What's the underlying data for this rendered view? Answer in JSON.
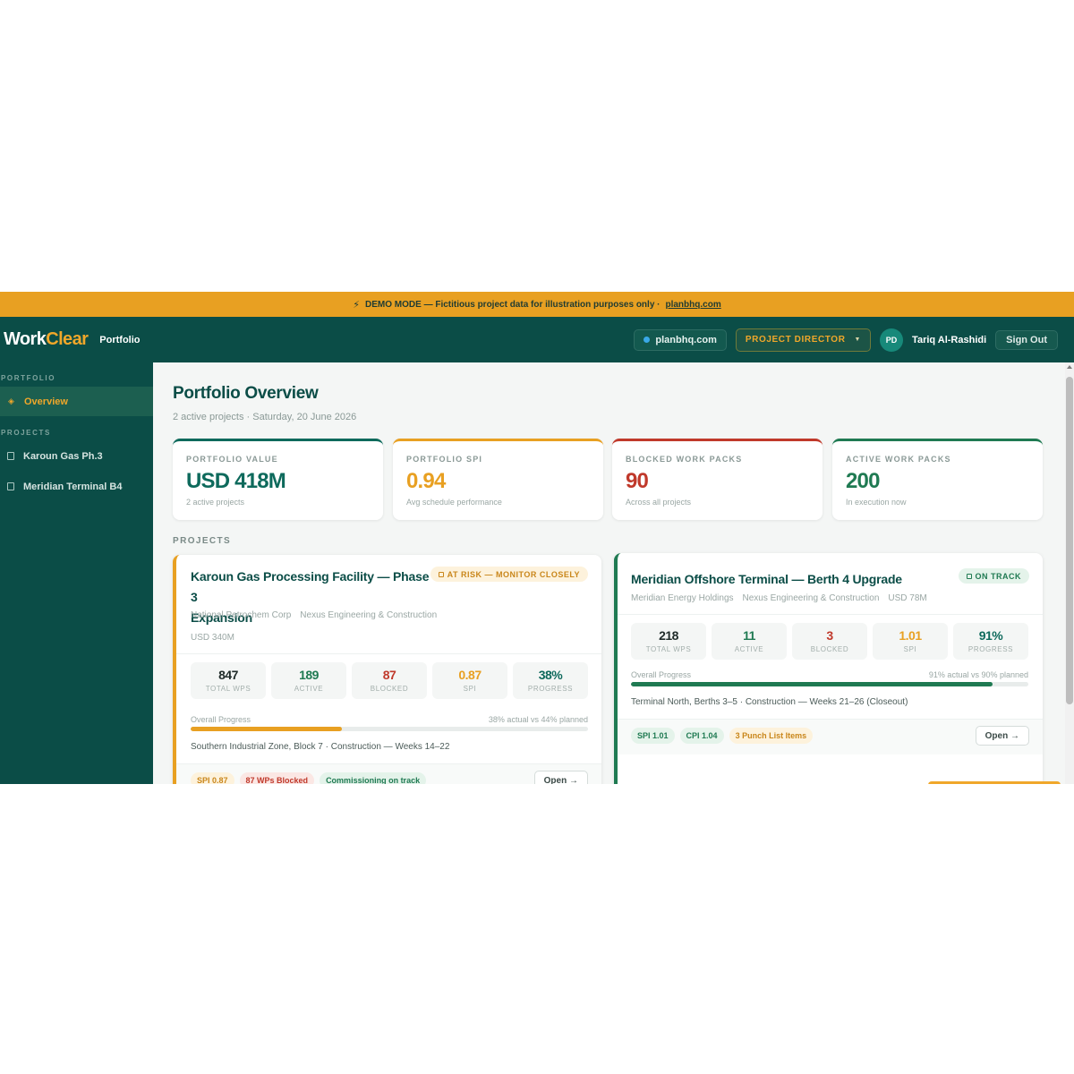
{
  "banner": {
    "text": "DEMO MODE — Fictitious project data for illustration purposes only ·",
    "link": "planbhq.com"
  },
  "header": {
    "logo_part1": "Work",
    "logo_part2": "Clear",
    "breadcrumb": "Portfolio",
    "domain_chip": "planbhq.com",
    "role": "PROJECT DIRECTOR",
    "avatar_initials": "PD",
    "user_name": "Tariq Al-Rashidi",
    "sign_out": "Sign Out"
  },
  "sidebar": {
    "portfolio_heading": "PORTFOLIO",
    "overview": "Overview",
    "projects_heading": "PROJECTS",
    "projects": [
      "Karoun Gas Ph.3",
      "Meridian Terminal B4"
    ]
  },
  "main": {
    "title": "Portfolio Overview",
    "subtitle": "2 active projects · Saturday, 20 June 2026",
    "projects_label": "PROJECTS"
  },
  "stats": [
    {
      "label": "PORTFOLIO VALUE",
      "value": "USD 418M",
      "hint": "2 active projects",
      "color": "#0e6a5c"
    },
    {
      "label": "PORTFOLIO SPI",
      "value": "0.94",
      "hint": "Avg schedule performance",
      "color": "#e8a022"
    },
    {
      "label": "BLOCKED WORK PACKS",
      "value": "90",
      "hint": "Across all projects",
      "color": "#c0392b"
    },
    {
      "label": "ACTIVE WORK PACKS",
      "value": "200",
      "hint": "In execution now",
      "color": "#1f7a52"
    }
  ],
  "projects": [
    {
      "title_line1": "Karoun Gas Processing Facility — Phase 3",
      "title_line2": "Expansion",
      "client": "National Petrochem Corp",
      "contractor": "Nexus Engineering & Construction",
      "value": "USD 340M",
      "status": "AT RISK — MONITOR CLOSELY",
      "metrics": [
        {
          "value": "847",
          "label": "TOTAL WPS"
        },
        {
          "value": "189",
          "label": "ACTIVE"
        },
        {
          "value": "87",
          "label": "BLOCKED"
        },
        {
          "value": "0.87",
          "label": "SPI"
        },
        {
          "value": "38%",
          "label": "PROGRESS"
        }
      ],
      "progress_label": "Overall Progress",
      "progress_text": "38% actual vs 44% planned",
      "progress_pct": 38,
      "location": "Southern Industrial Zone, Block 7 · Construction — Weeks 14–22",
      "chips": [
        "SPI 0.87",
        "87 WPs Blocked",
        "Commissioning on track"
      ],
      "open": "Open →"
    },
    {
      "title_line1": "Meridian Offshore Terminal — Berth 4 Upgrade",
      "client": "Meridian Energy Holdings",
      "contractor": "Nexus Engineering & Construction",
      "value": "USD 78M",
      "status": "ON TRACK",
      "metrics": [
        {
          "value": "218",
          "label": "TOTAL WPS"
        },
        {
          "value": "11",
          "label": "ACTIVE"
        },
        {
          "value": "3",
          "label": "BLOCKED"
        },
        {
          "value": "1.01",
          "label": "SPI"
        },
        {
          "value": "91%",
          "label": "PROGRESS"
        }
      ],
      "progress_label": "Overall Progress",
      "progress_text": "91% actual vs 90% planned",
      "progress_pct": 91,
      "location": "Terminal North, Berths 3–5 · Construction — Weeks 21–26 (Closeout)",
      "chips": [
        "SPI 1.01",
        "CPI 1.04",
        "3 Punch List Items"
      ],
      "open": "Open →"
    }
  ],
  "colors": {
    "brand": "#0b4d47",
    "accent": "#e8a022",
    "danger": "#c0392b",
    "success": "#1f7a52"
  }
}
